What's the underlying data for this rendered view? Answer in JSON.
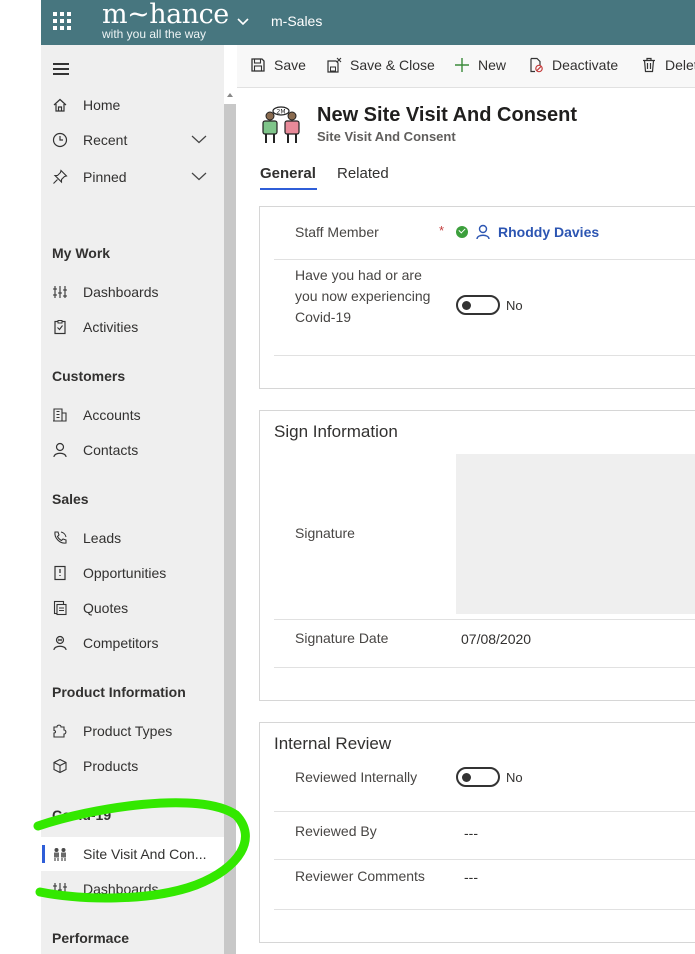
{
  "topbar": {
    "brand_name": "m~hance",
    "brand_tagline": "with you all the way",
    "app_name": "m-Sales"
  },
  "sidebar": {
    "items": [
      {
        "label": "Home",
        "icon": "home-icon"
      },
      {
        "label": "Recent",
        "icon": "clock-icon"
      },
      {
        "label": "Pinned",
        "icon": "pin-icon"
      }
    ],
    "groups": [
      {
        "title": "My Work",
        "items": [
          {
            "label": "Dashboards",
            "icon": "dashboard-icon"
          },
          {
            "label": "Activities",
            "icon": "clipboard-icon"
          }
        ]
      },
      {
        "title": "Customers",
        "items": [
          {
            "label": "Accounts",
            "icon": "building-icon"
          },
          {
            "label": "Contacts",
            "icon": "person-icon"
          }
        ]
      },
      {
        "title": "Sales",
        "items": [
          {
            "label": "Leads",
            "icon": "phone-icon"
          },
          {
            "label": "Opportunities",
            "icon": "document-icon"
          },
          {
            "label": "Quotes",
            "icon": "quote-icon"
          },
          {
            "label": "Competitors",
            "icon": "competitor-icon"
          }
        ]
      },
      {
        "title": "Product Information",
        "items": [
          {
            "label": "Product Types",
            "icon": "puzzle-icon"
          },
          {
            "label": "Products",
            "icon": "cube-icon"
          }
        ]
      },
      {
        "title": "Covid-19",
        "items": [
          {
            "label": "Site Visit And Con...",
            "icon": "site-visit-icon",
            "active": true
          },
          {
            "label": "Dashboards",
            "icon": "dashboard-icon"
          }
        ]
      },
      {
        "title": "Performace",
        "items": []
      }
    ]
  },
  "commands": {
    "save": "Save",
    "save_close": "Save & Close",
    "new": "New",
    "deactivate": "Deactivate",
    "delete": "Delet"
  },
  "record": {
    "title": "New Site Visit And Consent",
    "entity": "Site Visit And Consent",
    "tabs": [
      "General",
      "Related"
    ]
  },
  "general": {
    "staff_label": "Staff Member",
    "required_marker": "*",
    "staff_value": "Rhoddy Davies",
    "covid_label": "Have you had or are you now experiencing Covid-19",
    "covid_value": "No"
  },
  "sign": {
    "title": "Sign Information",
    "signature_label": "Signature",
    "date_label": "Signature Date",
    "date_value": "07/08/2020"
  },
  "review": {
    "title": "Internal Review",
    "reviewed_label": "Reviewed Internally",
    "reviewed_value": "No",
    "by_label": "Reviewed By",
    "by_value": "---",
    "comments_label": "Reviewer Comments",
    "comments_value": "---"
  },
  "colors": {
    "topbar": "#47767f",
    "accent": "#2f5ed8",
    "highlight": "#33e800"
  }
}
